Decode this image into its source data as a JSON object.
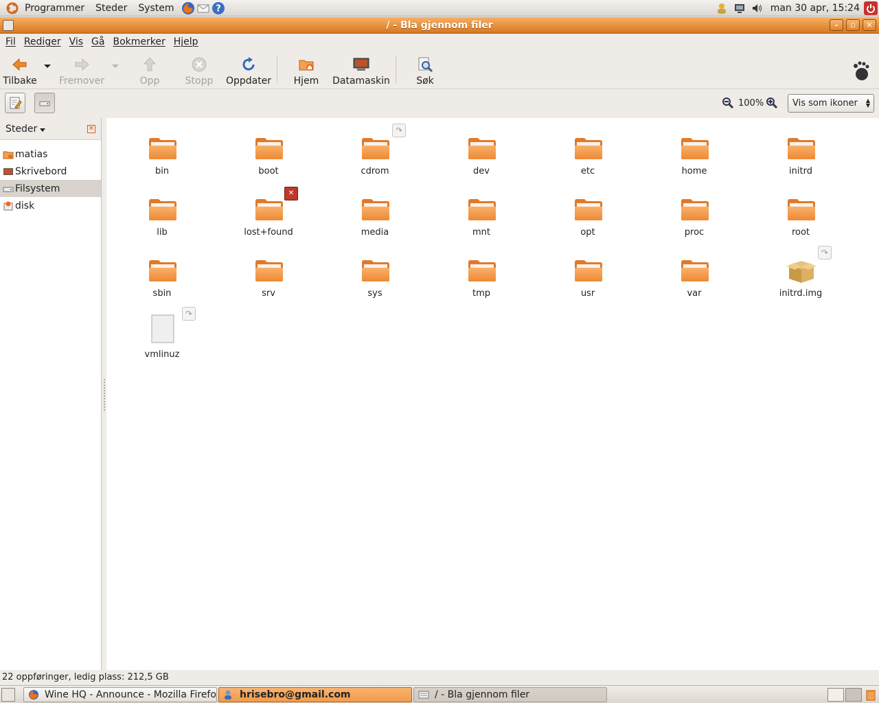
{
  "top_panel": {
    "menus": [
      "Programmer",
      "Steder",
      "System"
    ],
    "clock": "man 30 apr, 15:24"
  },
  "window": {
    "title": "/ - Bla gjennom filer"
  },
  "menubar": {
    "items": [
      "Fil",
      "Rediger",
      "Vis",
      "Gå",
      "Bokmerker",
      "Hjelp"
    ]
  },
  "toolbar": {
    "back": "Tilbake",
    "forward": "Fremover",
    "up": "Opp",
    "stop": "Stopp",
    "reload": "Oppdater",
    "home": "Hjem",
    "computer": "Datamaskin",
    "search": "Søk"
  },
  "location_bar": {
    "zoom": "100%",
    "view_mode": "Vis som ikoner"
  },
  "sidebar": {
    "title": "Steder",
    "places": [
      {
        "label": "matias",
        "selected": false
      },
      {
        "label": "Skrivebord",
        "selected": false
      },
      {
        "label": "Filsystem",
        "selected": true
      },
      {
        "label": "disk",
        "selected": false
      }
    ]
  },
  "files": [
    {
      "name": "bin",
      "type": "folder"
    },
    {
      "name": "boot",
      "type": "folder"
    },
    {
      "name": "cdrom",
      "type": "folder",
      "emblem": "link"
    },
    {
      "name": "dev",
      "type": "folder"
    },
    {
      "name": "etc",
      "type": "folder"
    },
    {
      "name": "home",
      "type": "folder"
    },
    {
      "name": "initrd",
      "type": "folder"
    },
    {
      "name": "lib",
      "type": "folder"
    },
    {
      "name": "lost+found",
      "type": "folder",
      "emblem": "noaccess"
    },
    {
      "name": "media",
      "type": "folder"
    },
    {
      "name": "mnt",
      "type": "folder"
    },
    {
      "name": "opt",
      "type": "folder"
    },
    {
      "name": "proc",
      "type": "folder"
    },
    {
      "name": "root",
      "type": "folder"
    },
    {
      "name": "sbin",
      "type": "folder"
    },
    {
      "name": "srv",
      "type": "folder"
    },
    {
      "name": "sys",
      "type": "folder"
    },
    {
      "name": "tmp",
      "type": "folder"
    },
    {
      "name": "usr",
      "type": "folder"
    },
    {
      "name": "var",
      "type": "folder"
    },
    {
      "name": "initrd.img",
      "type": "package",
      "emblem": "link"
    },
    {
      "name": "vmlinuz",
      "type": "file",
      "emblem": "link"
    }
  ],
  "statusbar": {
    "text": "22 oppføringer, ledig plass: 212,5 GB"
  },
  "taskbar": {
    "tasks": [
      {
        "label": "Wine HQ - Announce - Mozilla Firefox",
        "state": "normal"
      },
      {
        "label": "hrisebro@gmail.com",
        "state": "active"
      },
      {
        "label": "/ - Bla gjennom filer",
        "state": "pressed"
      }
    ]
  }
}
